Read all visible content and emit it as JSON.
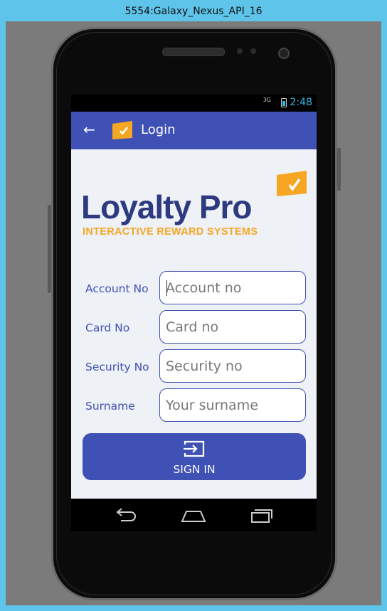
{
  "window": {
    "title": "5554:Galaxy_Nexus_API_16"
  },
  "status_bar": {
    "signal": "3G",
    "time": "2:48"
  },
  "app_bar": {
    "title": "Login"
  },
  "logo": {
    "name": "Loyalty Pro",
    "tagline": "INTERACTIVE REWARD SYSTEMS"
  },
  "form": {
    "fields": [
      {
        "label": "Account No",
        "placeholder": "Account no",
        "value": ""
      },
      {
        "label": "Card No",
        "placeholder": "Card no",
        "value": ""
      },
      {
        "label": "Security No",
        "placeholder": "Security no",
        "value": ""
      },
      {
        "label": "Surname",
        "placeholder": "Your surname",
        "value": ""
      }
    ],
    "submit_label": "SIGN IN"
  },
  "colors": {
    "primary": "#3f51b5",
    "accent": "#f5a623",
    "logo_text": "#2e3a7f",
    "status_accent": "#33b5e5"
  },
  "icons": {
    "back": "arrow-left-icon",
    "app": "loyalty-badge-icon",
    "signin": "login-icon",
    "nav": [
      "back-nav-icon",
      "home-nav-icon",
      "recents-nav-icon"
    ]
  }
}
